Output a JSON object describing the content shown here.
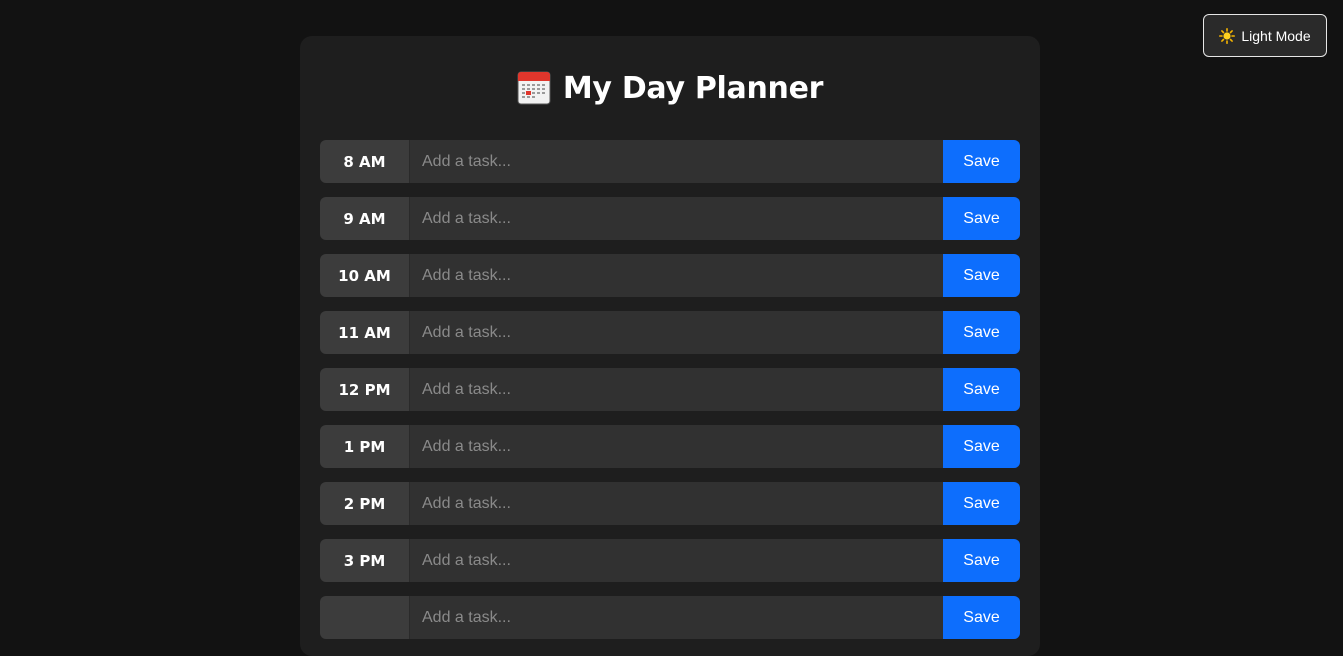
{
  "theme_toggle": {
    "icon": "sun-icon",
    "label": "Light Mode"
  },
  "header": {
    "icon": "calendar-icon",
    "title": "My Day Planner"
  },
  "colors": {
    "background": "#121212",
    "card": "#1e1e1e",
    "hour_block": "#3c3c3c",
    "input": "#313131",
    "accent": "#0d6efd"
  },
  "planner": {
    "placeholder": "Add a task...",
    "save_label": "Save",
    "hours": [
      {
        "label": "8 AM",
        "task": ""
      },
      {
        "label": "9 AM",
        "task": ""
      },
      {
        "label": "10 AM",
        "task": ""
      },
      {
        "label": "11 AM",
        "task": ""
      },
      {
        "label": "12 PM",
        "task": ""
      },
      {
        "label": "1 PM",
        "task": ""
      },
      {
        "label": "2 PM",
        "task": ""
      },
      {
        "label": "3 PM",
        "task": ""
      },
      {
        "label": "",
        "task": ""
      }
    ]
  }
}
